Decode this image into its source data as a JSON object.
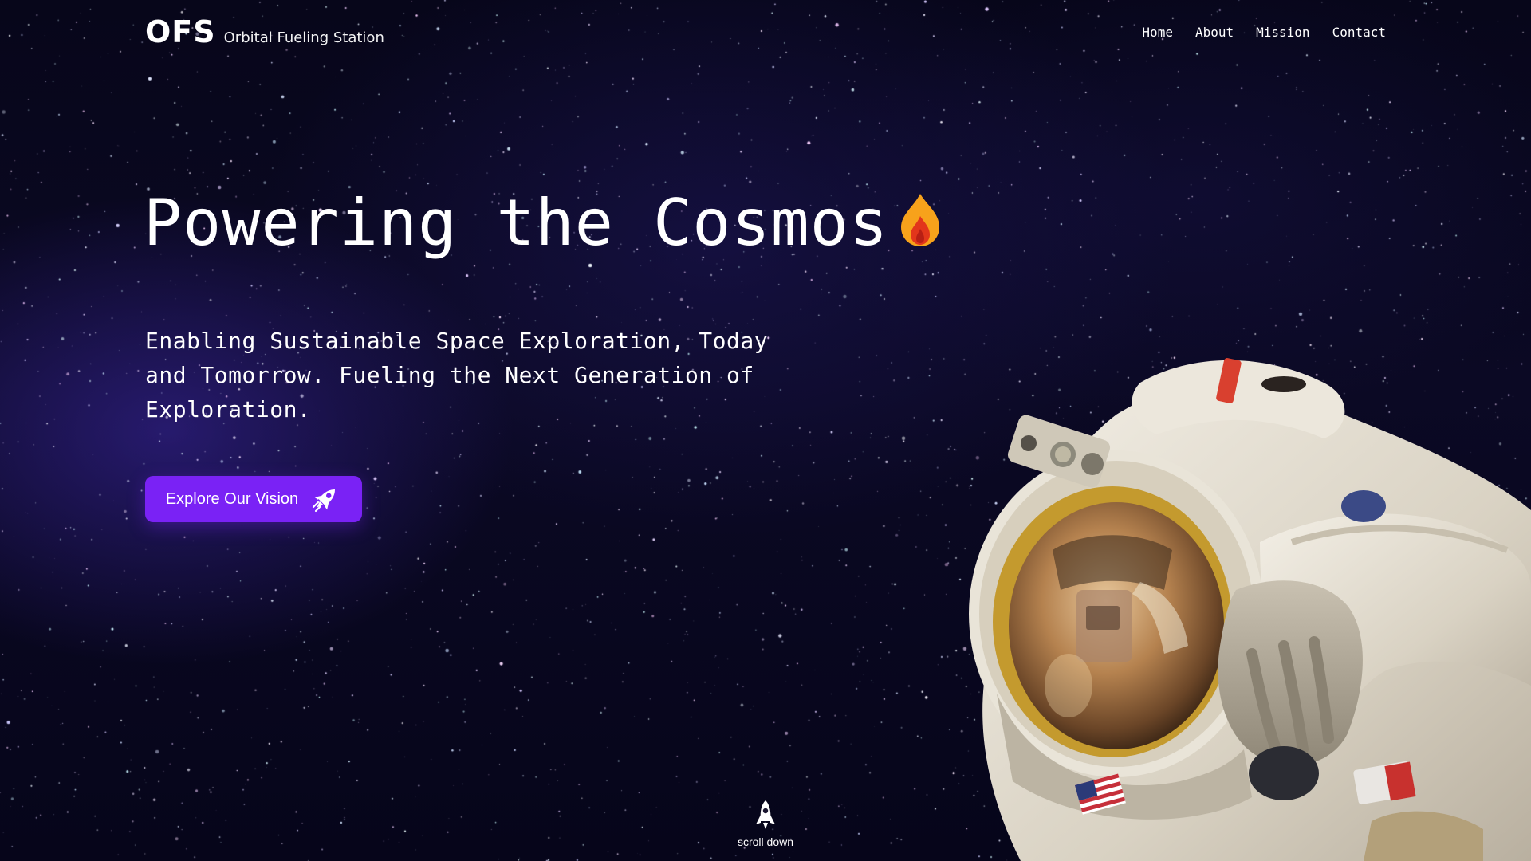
{
  "brand": {
    "logo": "OFS",
    "tagline": "Orbital Fueling Station"
  },
  "nav": {
    "items": [
      {
        "label": "Home"
      },
      {
        "label": "About"
      },
      {
        "label": "Mission"
      },
      {
        "label": "Contact"
      }
    ]
  },
  "hero": {
    "headline": "Powering the Cosmos",
    "headline_icon": "flame-icon",
    "subtext": "Enabling Sustainable Space Exploration, Today and Tomorrow. Fueling the Next Generation of Exploration.",
    "cta_label": "Explore Our Vision",
    "cta_icon": "rocket-icon",
    "image": "astronaut-illustration"
  },
  "scroll": {
    "label": "scroll down",
    "icon": "rocket-icon"
  },
  "colors": {
    "background": "#07061a",
    "accent": "#7a22f5",
    "text": "#ffffff",
    "flame_outer": "#f7a21b",
    "flame_inner": "#e2361b"
  }
}
